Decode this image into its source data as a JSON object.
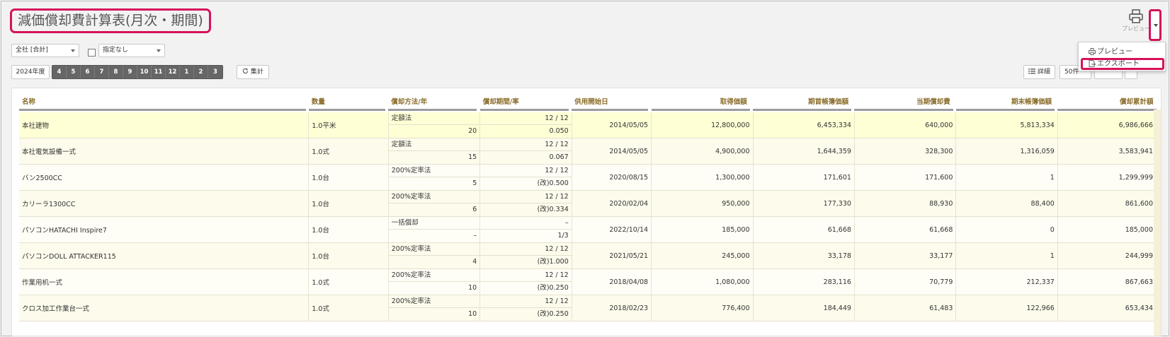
{
  "title": "減価償却費計算表(月次・期間)",
  "print_label": "プレビュー",
  "filters": {
    "company": "全社 [合計]",
    "designation": "指定なし"
  },
  "year_button": "2024年度",
  "months": [
    "4",
    "5",
    "6",
    "7",
    "8",
    "9",
    "10",
    "11",
    "12",
    "1",
    "2",
    "3"
  ],
  "tally_button": "集計",
  "detail_button": "詳細",
  "count_select": "50件",
  "menu": {
    "preview": "プレビュー",
    "export": "エクスポート"
  },
  "table": {
    "headers": {
      "name": "名称",
      "quantity": "数量",
      "method": "償却方法/年",
      "period": "償却期間/率",
      "start": "供用開始日",
      "acquisition": "取得価額",
      "opening_book": "期首帳簿価額",
      "current_dep": "当期償却費",
      "closing_book": "期末帳簿価額",
      "accumulated": "償却累計額"
    },
    "rows": [
      {
        "name": "本社建物",
        "quantity": "1.0平米",
        "method": "定額法",
        "years": "20",
        "period": "12 / 12",
        "rate": "0.050",
        "start": "2014/05/05",
        "acquisition": "12,800,000",
        "opening_book": "6,453,334",
        "current_dep": "640,000",
        "closing_book": "5,813,334",
        "accumulated": "6,986,666"
      },
      {
        "name": "本社電気設備一式",
        "quantity": "1.0式",
        "method": "定額法",
        "years": "15",
        "period": "12 / 12",
        "rate": "0.067",
        "start": "2014/05/05",
        "acquisition": "4,900,000",
        "opening_book": "1,644,359",
        "current_dep": "328,300",
        "closing_book": "1,316,059",
        "accumulated": "3,583,941"
      },
      {
        "name": "バン2500CC",
        "quantity": "1.0台",
        "method": "200%定率法",
        "years": "5",
        "period": "12 / 12",
        "rate": "(改)0.500",
        "start": "2020/08/15",
        "acquisition": "1,300,000",
        "opening_book": "171,601",
        "current_dep": "171,600",
        "closing_book": "1",
        "accumulated": "1,299,999"
      },
      {
        "name": "カリーラ1300CC",
        "quantity": "1.0台",
        "method": "200%定率法",
        "years": "6",
        "period": "12 / 12",
        "rate": "(改)0.334",
        "start": "2020/02/04",
        "acquisition": "950,000",
        "opening_book": "177,330",
        "current_dep": "88,930",
        "closing_book": "88,400",
        "accumulated": "861,600"
      },
      {
        "name": "パソコンHATACHI Inspire7",
        "quantity": "1.0台",
        "method": "一括償却",
        "years": "–",
        "period": "–",
        "rate": "1/3",
        "start": "2022/10/14",
        "acquisition": "185,000",
        "opening_book": "61,668",
        "current_dep": "61,668",
        "closing_book": "0",
        "accumulated": "185,000"
      },
      {
        "name": "パソコンDOLL ATTACKER115",
        "quantity": "1.0台",
        "method": "200%定率法",
        "years": "4",
        "period": "12 / 12",
        "rate": "(改)1.000",
        "start": "2021/05/21",
        "acquisition": "245,000",
        "opening_book": "33,178",
        "current_dep": "33,177",
        "closing_book": "1",
        "accumulated": "244,999"
      },
      {
        "name": "作業用机一式",
        "quantity": "1.0式",
        "method": "200%定率法",
        "years": "10",
        "period": "12 / 12",
        "rate": "(改)0.250",
        "start": "2018/04/08",
        "acquisition": "1,080,000",
        "opening_book": "283,116",
        "current_dep": "70,779",
        "closing_book": "212,337",
        "accumulated": "867,663"
      },
      {
        "name": "クロス加工作業台一式",
        "quantity": "1.0式",
        "method": "200%定率法",
        "years": "10",
        "period": "12 / 12",
        "rate": "(改)0.250",
        "start": "2018/02/23",
        "acquisition": "776,400",
        "opening_book": "184,449",
        "current_dep": "61,483",
        "closing_book": "122,966",
        "accumulated": "653,434"
      }
    ]
  },
  "icons": {
    "print": "printer-icon",
    "refresh": "refresh-icon",
    "list": "list-icon",
    "export": "export-icon"
  }
}
